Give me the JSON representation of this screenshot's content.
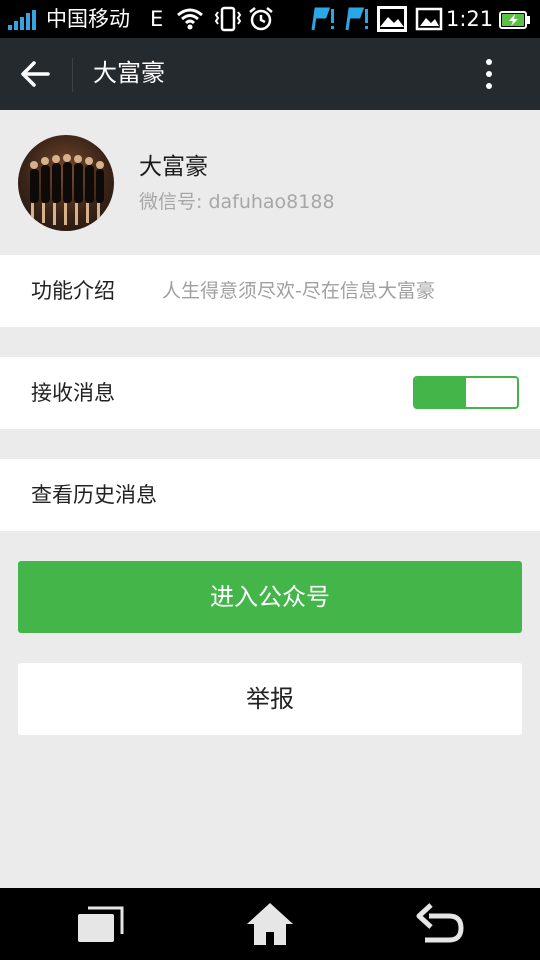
{
  "status_bar": {
    "carrier": "中国移动",
    "network": "E",
    "time": "1:21",
    "icons": [
      "signal-icon",
      "wifi-icon",
      "vibrate-icon",
      "alarm-icon",
      "flag-icon",
      "flag-icon",
      "image-icon",
      "screenshot-icon",
      "battery-charging-icon"
    ]
  },
  "app_bar": {
    "title": "大富豪",
    "icons": [
      "back-arrow-icon",
      "more-vert-icon"
    ]
  },
  "profile": {
    "name": "大富豪",
    "wechat_id": "微信号: dafuhao8188"
  },
  "settings": {
    "intro_label": "功能介绍",
    "intro_value": "人生得意须尽欢-尽在信息大富豪",
    "receive_label": "接收消息",
    "receive_enabled": true,
    "history_label": "查看历史消息"
  },
  "buttons": {
    "enter_label": "进入公众号",
    "report_label": "举报"
  },
  "colors": {
    "accent": "#44b549",
    "app_bar": "#242a2e",
    "background": "#ebebeb"
  },
  "nav_bar": {
    "icons": [
      "recent-apps-icon",
      "home-icon",
      "back-icon"
    ]
  }
}
